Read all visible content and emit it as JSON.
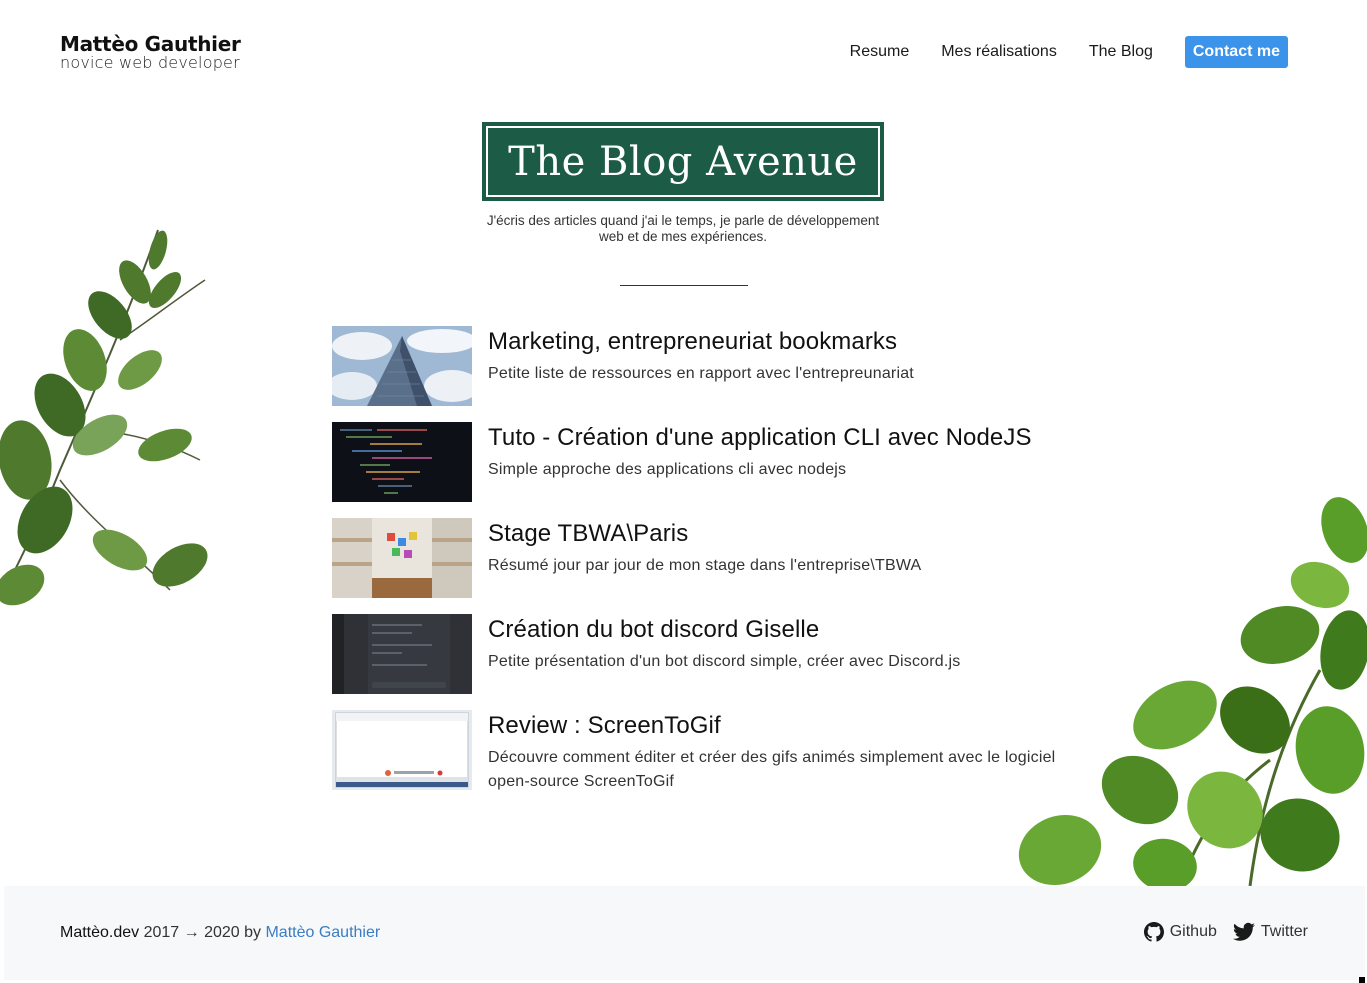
{
  "header": {
    "brand_name": "Mattèo Gauthier",
    "brand_tagline": "novice web developer",
    "nav": [
      {
        "label": "Resume"
      },
      {
        "label": "Mes réalisations"
      },
      {
        "label": "The Blog"
      },
      {
        "label": "Contact me"
      }
    ]
  },
  "blog": {
    "title": "The Blog Avenue",
    "intro": "J'écris des articles quand j'ai le temps, je parle de développement web et de mes expériences."
  },
  "posts": [
    {
      "title": "Marketing, entrepreneuriat bookmarks",
      "description": "Petite liste de ressources en rapport avec l'entrepreunariat"
    },
    {
      "title": "Tuto - Création d'une application CLI avec NodeJS",
      "description": "Simple approche des applications cli avec nodejs"
    },
    {
      "title": "Stage TBWA\\Paris",
      "description": "Résumé jour par jour de mon stage dans l'entreprise\\TBWA"
    },
    {
      "title": "Création du bot discord Giselle",
      "description": "Petite présentation d'un bot discord simple, créer avec Discord.js"
    },
    {
      "title": "Review : ScreenToGif",
      "description": "Découvre comment éditer et créer des gifs animés simplement avec le logiciel open-source ScreenToGif"
    }
  ],
  "footer": {
    "site": "Mattèo.dev",
    "years": " 2017 → 2020 by ",
    "author": "Mattèo Gauthier",
    "links": [
      {
        "label": "Github",
        "icon": "github-icon"
      },
      {
        "label": "Twitter",
        "icon": "twitter-icon"
      }
    ]
  },
  "colors": {
    "accent": "#3b93ea",
    "logo_bg": "#1c5b45",
    "author_link": "#3a7dc2"
  }
}
